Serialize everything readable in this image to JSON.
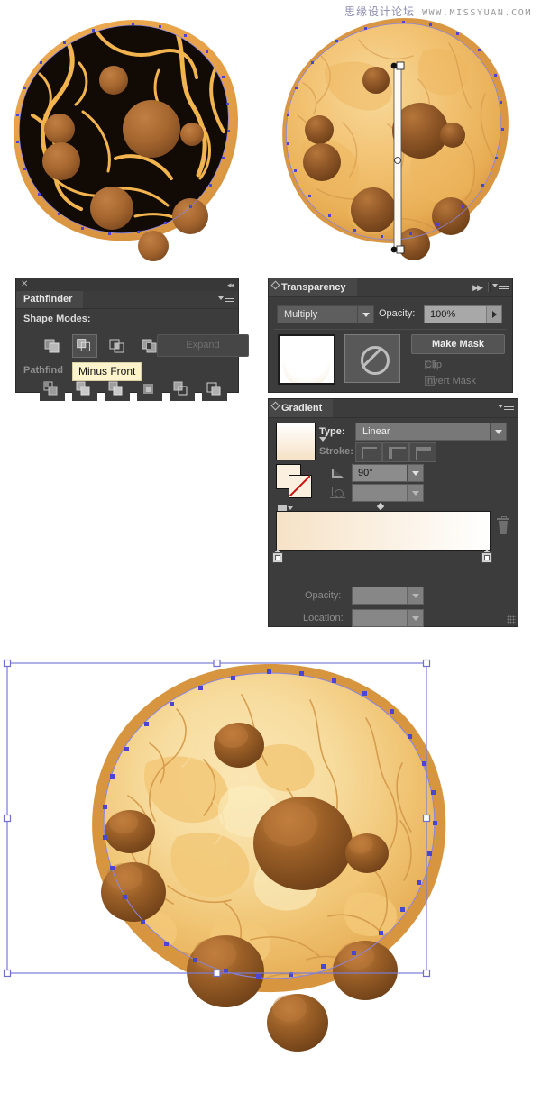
{
  "watermark": {
    "cn": "思缘设计论坛",
    "url": "WWW.MISSYUAN.COM"
  },
  "pathfinder": {
    "title": "Pathfinder",
    "close_icon": "close-icon",
    "collapse_icon": "collapse-icon",
    "menu_icon": "panel-menu-icon",
    "shape_modes_label": "Shape Modes:",
    "pathfinders_label": "Pathfind",
    "expand_label": "Expand",
    "tooltip": "Minus Front",
    "shape_mode_buttons": [
      {
        "name": "unite",
        "selected": false
      },
      {
        "name": "minus-front",
        "selected": true
      },
      {
        "name": "intersect",
        "selected": false
      },
      {
        "name": "exclude",
        "selected": false
      }
    ],
    "pathfinder_buttons": [
      {
        "name": "divide"
      },
      {
        "name": "trim"
      },
      {
        "name": "merge"
      },
      {
        "name": "crop"
      },
      {
        "name": "outline"
      },
      {
        "name": "minus-back"
      }
    ]
  },
  "transparency": {
    "title": "Transparency",
    "blend_mode": "Multiply",
    "opacity_label": "Opacity:",
    "opacity_value": "100%",
    "make_mask_label": "Make Mask",
    "clip_label": "Clip",
    "invert_mask_label": "Invert Mask",
    "clip_checked": false,
    "invert_checked": false,
    "menu_icon": "panel-menu-icon",
    "expand_icon": "double-arrow-icon",
    "art_thumbnail": "artwork-thumbnail",
    "mask_thumbnail": "no-mask-thumbnail"
  },
  "gradient": {
    "title": "Gradient",
    "type_label": "Type:",
    "type_value": "Linear",
    "stroke_label": "Stroke:",
    "angle_value": "90°",
    "aspect_value": "",
    "opacity_label": "Opacity:",
    "opacity_value": "",
    "location_label": "Location:",
    "location_value": "",
    "menu_icon": "panel-menu-icon",
    "swatch_preview": "gradient-swatch",
    "fill_stroke_icon": "fill-stroke-indicator",
    "gradient_type_icon": "gradient-presets-icon",
    "delete_stop_icon": "trash-icon",
    "stops": [
      {
        "name": "gradient-stop-start",
        "position_pct": 0,
        "color": "#f6e2c6"
      },
      {
        "name": "gradient-stop-end",
        "position_pct": 100,
        "color": "#ffffff"
      }
    ],
    "midpoint_pct": 48,
    "stroke_buttons": [
      {
        "name": "stroke-within"
      },
      {
        "name": "stroke-along"
      },
      {
        "name": "stroke-across"
      }
    ]
  },
  "artwork": {
    "cookie_dark": {
      "name": "cookie-with-black-overlay",
      "dough_color": "#e8a34a",
      "overlay_color": "#120a05",
      "crack_color": "#f2b44e",
      "chip_color": "#a5662f"
    },
    "cookie_gradient": {
      "name": "cookie-with-gradient-annotator",
      "dough_light": "#f6d08f",
      "dough_mid": "#eeb55e",
      "dough_edge": "#d99743",
      "chip_dark": "#7b4a1f",
      "chip_light": "#b5763a",
      "annotator": "gradient-annotator-bar"
    },
    "cookie_final": {
      "name": "finished-cookie-selected",
      "dough_light": "#f7dc9e",
      "dough_mid": "#f0bd63",
      "dough_edge": "#d8953f",
      "chip_dark": "#6f4018",
      "chip_light": "#b9773a",
      "selection_color": "#7b7bd8"
    },
    "anchor_color": "#4a46d2",
    "path_color": "#8a86e0"
  }
}
